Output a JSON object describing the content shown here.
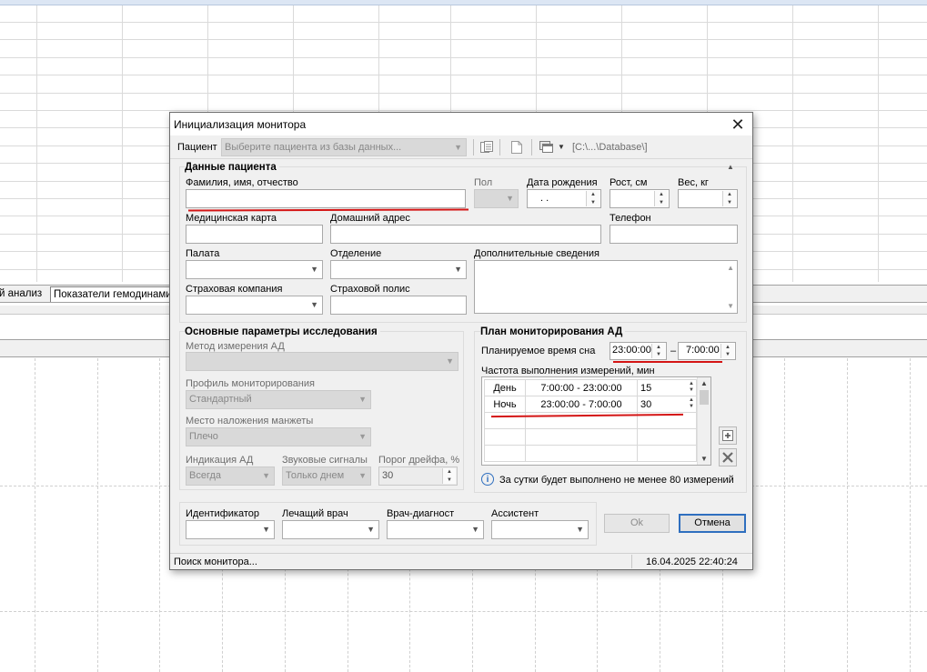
{
  "background": {
    "sheet_tabs": [
      "й анализ",
      "Показатели гемодинами"
    ]
  },
  "dialog": {
    "title": "Инициализация монитора",
    "close_glyph": "✕",
    "toolbar": {
      "patient_label": "Пациент",
      "patient_select_placeholder": "Выберите пациента из базы данных...",
      "db_path": "[C:\\...\\Database\\]"
    },
    "patient_data": {
      "title": "Данные пациента",
      "fio_label": "Фамилия, имя, отчество",
      "fio_value": "",
      "sex_label": "Пол",
      "birth_label": "Дата рождения",
      "birth_value": "  .  .",
      "height_label": "Рост, см",
      "weight_label": "Вес, кг",
      "medcard_label": "Медицинская карта",
      "address_label": "Домашний адрес",
      "phone_label": "Телефон",
      "ward_label": "Палата",
      "department_label": "Отделение",
      "extra_label": "Дополнительные сведения",
      "insurance_label": "Страховая компания",
      "policy_label": "Страховой полис"
    },
    "study_params": {
      "title": "Основные параметры исследования",
      "method_label": "Метод измерения АД",
      "method_value": "",
      "profile_label": "Профиль мониторирования",
      "profile_value": "Стандартный",
      "cuff_label": "Место наложения манжеты",
      "cuff_value": "Плечо",
      "indication_label": "Индикация АД",
      "indication_value": "Всегда",
      "sound_label": "Звуковые сигналы",
      "sound_value": "Только днем",
      "drift_label": "Порог дрейфа, %",
      "drift_value": "30"
    },
    "bp_plan": {
      "title": "План мониторирования АД",
      "sleep_label": "Планируемое время сна",
      "sleep_from": "23:00:00",
      "sleep_dash": "–",
      "sleep_to": "7:00:00",
      "freq_label": "Частота выполнения измерений, мин",
      "rows": [
        {
          "period": "День",
          "range": "7:00:00 - 23:00:00",
          "interval": "15"
        },
        {
          "period": "Ночь",
          "range": "23:00:00 - 7:00:00",
          "interval": "30"
        }
      ],
      "info_text": "За сутки будет выполнено не менее 80 измерений"
    },
    "staff": {
      "identifier_label": "Идентификатор",
      "doctor_label": "Лечащий врач",
      "diagnostician_label": "Врач-диагност",
      "assistant_label": "Ассистент"
    },
    "buttons": {
      "ok": "Ok",
      "cancel": "Отмена"
    },
    "status": {
      "left": "Поиск монитора...",
      "right": "16.04.2025 22:40:24"
    }
  }
}
